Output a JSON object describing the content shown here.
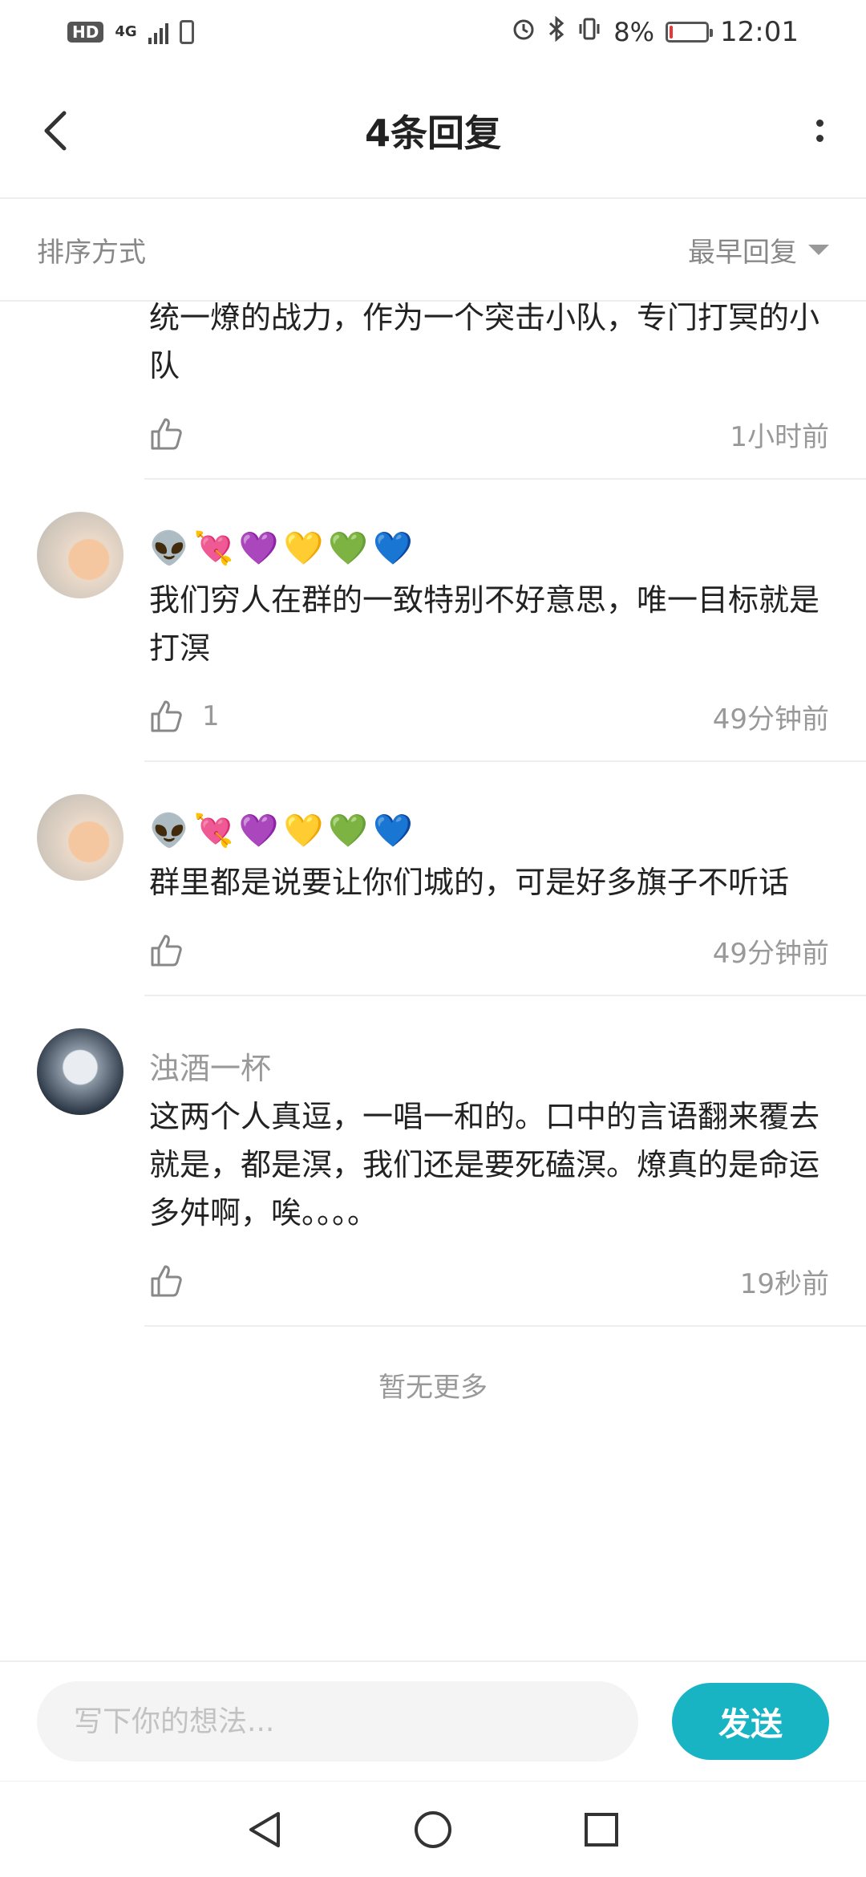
{
  "status_bar": {
    "hd": "HD",
    "network": "4G",
    "battery_percent": "8%",
    "battery_level": 0.08,
    "time": "12:01"
  },
  "header": {
    "title": "4条回复"
  },
  "sort": {
    "label": "排序方式",
    "value": "最早回复"
  },
  "comments": [
    {
      "username": "",
      "emoji": [],
      "text": "统一燎的战力，作为一个突击小队，专门打冥的小队",
      "likes": "",
      "time": "1小时前"
    },
    {
      "username": "",
      "emoji": [
        "👽",
        "💘",
        "💜",
        "💛",
        "💚",
        "💙"
      ],
      "text": "我们穷人在群的一致特别不好意思，唯一目标就是打溟",
      "likes": "1",
      "time": "49分钟前"
    },
    {
      "username": "",
      "emoji": [
        "👽",
        "💘",
        "💜",
        "💛",
        "💚",
        "💙"
      ],
      "text": "群里都是说要让你们城的，可是好多旗子不听话",
      "likes": "",
      "time": "49分钟前"
    },
    {
      "username": "浊酒一杯",
      "emoji": [],
      "text": "这两个人真逗，一唱一和的。口中的言语翻来覆去就是，都是溟，我们还是要死磕溟。燎真的是命运多舛啊，唉。。。。",
      "likes": "",
      "time": "19秒前"
    }
  ],
  "footer": {
    "no_more": "暂无更多"
  },
  "input": {
    "placeholder": "写下你的想法...",
    "send_label": "发送"
  },
  "colors": {
    "accent": "#19b4c3",
    "battery_low": "#e53935"
  },
  "icons": {
    "back": "chevron-left-icon",
    "more": "more-vertical-icon",
    "like": "thumbs-up-icon",
    "nav_back": "triangle-back-icon",
    "nav_home": "circle-home-icon",
    "nav_recent": "square-recent-icon"
  }
}
